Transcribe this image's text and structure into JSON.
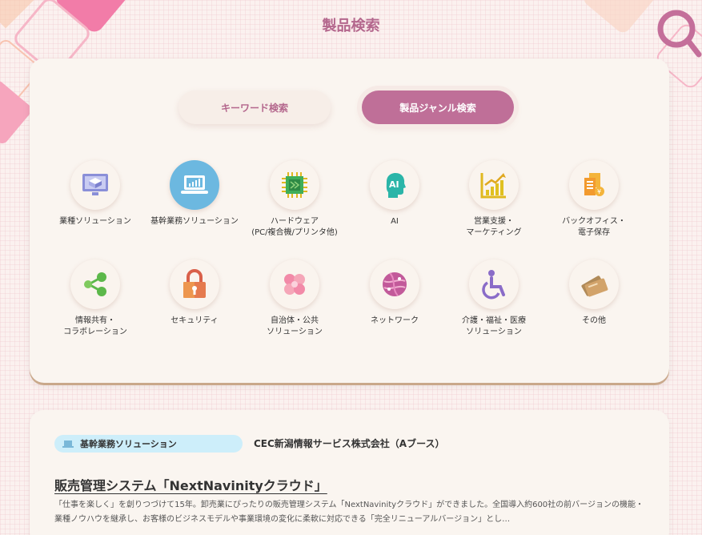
{
  "page": {
    "title": "製品検索"
  },
  "tabs": [
    {
      "label": "キーワード検索",
      "active": false
    },
    {
      "label": "製品ジャンル検索",
      "active": true
    }
  ],
  "categories": [
    {
      "label": "業種ソリューション",
      "icon": "monitor-3d-icon"
    },
    {
      "label": "基幹業務ソリューション",
      "icon": "laptop-chart-icon",
      "active": true
    },
    {
      "label": "ハードウェア\n(PC/複合機/プリンタ他)",
      "icon": "chip-icon"
    },
    {
      "label": "AI",
      "icon": "ai-head-icon"
    },
    {
      "label": "営業支援・\nマーケティング",
      "icon": "growth-chart-icon"
    },
    {
      "label": "バックオフィス・\n電子保存",
      "icon": "documents-icon"
    },
    {
      "label": "情報共有・\nコラボレーション",
      "icon": "share-icon"
    },
    {
      "label": "セキュリティ",
      "icon": "lock-icon"
    },
    {
      "label": "自治体・公共\nソリューション",
      "icon": "clover-icon"
    },
    {
      "label": "ネットワーク",
      "icon": "globe-icon"
    },
    {
      "label": "介護・福祉・医療\nソリューション",
      "icon": "wheelchair-icon"
    },
    {
      "label": "その他",
      "icon": "cards-icon"
    }
  ],
  "result": {
    "genre": "基幹業務ソリューション",
    "company": "CEC新潟情報サービス株式会社（Aブース）",
    "title": "販売管理システム「NextNavinityクラウド」",
    "description": "「仕事を楽しく」を創りつづけて15年。卸売業にぴったりの販売管理システム「NextNavinityクラウド」ができました。全国導入約600社の前バージョンの機能・業種ノウハウを継承し、お客様のビジネスモデルや事業環境の変化に柔軟に対応できる「完全リニューアルバージョン」とし…"
  },
  "colors": {
    "accent": "#bf6f98",
    "title": "#b4678d",
    "active_category": "#6cb8e0",
    "badge": "#cdeefa"
  }
}
